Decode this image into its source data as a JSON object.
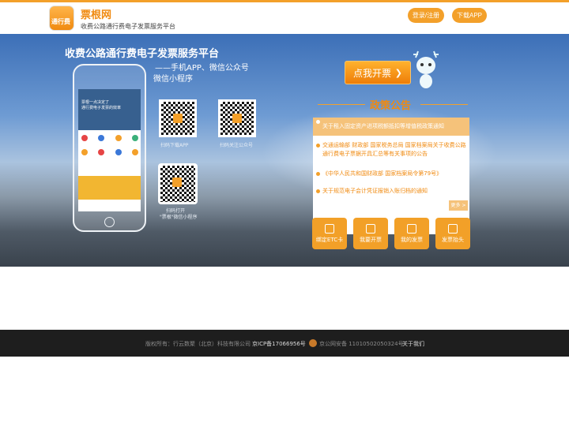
{
  "header": {
    "logo_text": "通行费",
    "brand": "票根网",
    "tagline": "收费公路通行费电子发票服务平台",
    "login_label": "登录/注册",
    "download_label": "下载APP"
  },
  "banner": {
    "title": "收费公路通行费电子发票服务平台",
    "subtitle_1": "——手机APP、微信公众号",
    "subtitle_2": "微信小程序",
    "phone_screen_text_1": "票根一点决定了",
    "phone_screen_text_2": "通行费电子发票的效率",
    "qr_captions": [
      "扫码下载APP",
      "扫码关注公众号",
      "扫码打开",
      "\"票根\"微信小程序"
    ],
    "ticket_button_label": "点我开票",
    "notice_title": "政策公告",
    "notices": [
      "关于租入固定资产进项税额抵扣等增值税政策通知",
      "交通运输部 财政部 国家税务总局 国家档案局关于收费公路通行费电子票据开具汇总等有关事项的公告",
      "《中华人民共和国财政部 国家档案局令第79号》",
      "关于规范电子会计凭证报销入账归档的通知"
    ],
    "more_label": "更多 >",
    "tiles": [
      "绑定ETC卡",
      "我要开票",
      "我的发票",
      "发票抬头"
    ]
  },
  "footer": {
    "copyright": "版权所有：行云数聚（北京）科技有限公司",
    "icp": "京ICP备17066956号",
    "police": "京公网安备 11010502050324号",
    "about": "关于我们"
  },
  "colors": {
    "accent": "#f3a02a",
    "footer_bg": "#1e1e1e"
  }
}
